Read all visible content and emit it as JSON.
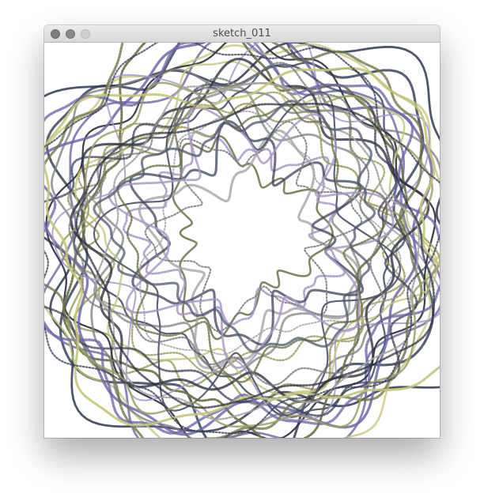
{
  "window": {
    "title": "sketch_011"
  },
  "controls": {
    "close_icon": "close-icon",
    "minimize_icon": "minimize-icon",
    "zoom_icon": "zoom-icon"
  },
  "palette": {
    "olive": "#6f7349",
    "olive_light": "#9c9d63",
    "gray": "#7d7d7d",
    "gray_light": "#a6a6a6",
    "slate": "#53596e",
    "navy": "#3c4056",
    "purple": "#6e67a8",
    "lavender": "#a899c5",
    "pale_yellow": "#c3c67a",
    "dark": "#2f3240"
  }
}
